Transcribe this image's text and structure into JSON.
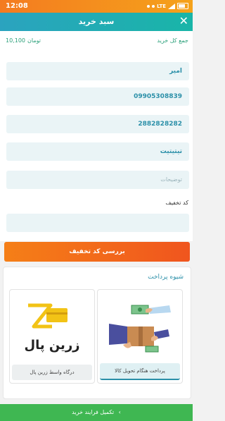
{
  "status_bar": {
    "time": "12:08",
    "network": "LTE"
  },
  "header": {
    "title": "سبد خرید",
    "close_icon": "close-icon"
  },
  "total": {
    "label": "جمع کل خرید",
    "amount": "10,100",
    "currency": "تومان"
  },
  "form": {
    "name": "امیر",
    "mobile": "09905308839",
    "phone": "2882828282",
    "address": "تیتیتیت",
    "notes_placeholder": "توضیحات",
    "discount_label": "کد تخفیف",
    "discount_value": ""
  },
  "discount_button": "بررسی کد تخفیف",
  "payment": {
    "title": "شیوه پرداخت",
    "options": [
      {
        "caption": "پرداخت هنگام تحویل کالا",
        "icon": "cash-on-delivery-icon",
        "selected": true
      },
      {
        "caption": "درگاه واسط زرین پال",
        "icon": "zarinpal-logo",
        "logo_text": "زرین پال",
        "selected": false
      }
    ]
  },
  "footer": {
    "label": "تکمیل فرایند خرید",
    "chevron": "‹"
  },
  "colors": {
    "primary": "#2ba3bf",
    "accent": "#f57f17",
    "success": "#3fb752"
  }
}
